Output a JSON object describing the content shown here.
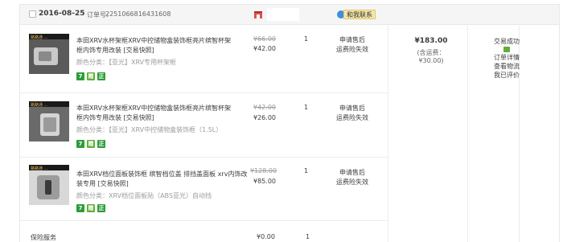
{
  "order": {
    "date": "2016-08-25",
    "order_no_label": "订单号:",
    "order_no": "2251066816431608",
    "contact_label": "和我联系",
    "total": "¥183.00",
    "shipping": "(含运费：¥30.00)",
    "status": {
      "text": "交易成功",
      "detail": "订单详情",
      "logistics": "查看物流",
      "review": "我已评价"
    }
  },
  "items": [
    {
      "thumb_text": "路路通 ...",
      "title": "本田XRV水杯架框XRV中控储物盒装饰框亮片缤智杯架框内饰专用改装 [交易快照]",
      "attr": "颜色分类：【亚光】XRV专用杯架框",
      "price_old": "¥66.00",
      "price_new": "¥42.00",
      "qty": "1",
      "aftersale_1": "申请售后",
      "aftersale_2": "运费险失效",
      "badges": [
        "7",
        "赠",
        "正"
      ]
    },
    {
      "thumb_text": "路路通 ...",
      "title": "本田XRV水杯架框XRV中控储物盒装饰框亮片缤智杯架框内饰专用改装 [交易快照]",
      "attr": "颜色分类：【亚光】XRV中控储物盒装饰框（1.5L）",
      "price_old": "¥42.00",
      "price_new": "¥26.00",
      "qty": "1",
      "aftersale_1": "申请售后",
      "aftersale_2": "运费险失效",
      "badges": [
        "7",
        "赠",
        "正"
      ]
    },
    {
      "thumb_text": "路路通 ...",
      "title": "本田XRV档位面板装饰框 缤智档位盖 排挡盖面板 xrv内饰改装专用 [交易快照]",
      "attr": "颜色分类：XRV档位面板贴（ABS亚光）自动挡",
      "price_old": "¥128.00",
      "price_new": "¥85.00",
      "qty": "1",
      "aftersale_1": "申请售后",
      "aftersale_2": "运费险失效",
      "badges": [
        "7",
        "赠",
        "正"
      ]
    }
  ],
  "insurance": {
    "label": "保险服务",
    "price": "¥0.00",
    "qty": "1"
  },
  "colors": {
    "header_bg": "#f5f5f5",
    "badge_green": "#2e9c3a",
    "contact_bg": "#f5e6a8"
  }
}
